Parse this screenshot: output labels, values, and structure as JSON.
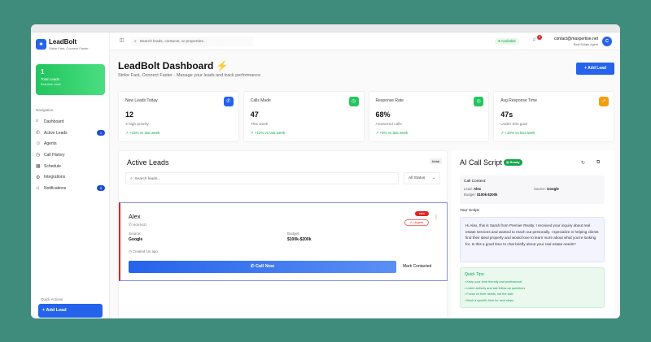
{
  "app": {
    "name": "LeadBolt",
    "tagline": "Strike Fast, Connect Faster"
  },
  "sidebar": {
    "total": {
      "value": "1",
      "label": "Total Leads",
      "sub": "Real-time count"
    },
    "nav_heading": "Navigation",
    "items": [
      {
        "label": "Dashboard",
        "icon": "⌕"
      },
      {
        "label": "Active Leads",
        "icon": "✆",
        "badge": "1"
      },
      {
        "label": "Agents",
        "icon": "☺"
      },
      {
        "label": "Call History",
        "icon": "◷"
      },
      {
        "label": "Schedule",
        "icon": "▦"
      },
      {
        "label": "Integrations",
        "icon": "⚙"
      },
      {
        "label": "Notifications",
        "icon": "♫",
        "badge": "5"
      }
    ],
    "quick_actions": "Quick Actions",
    "add_lead": "+ Add Lead"
  },
  "topbar": {
    "search_placeholder": "Search leads, contacts, or properties...",
    "status": "● Available",
    "notif_count": "2",
    "email": "contact@maxpertise.net",
    "role": "Real Estate Agent",
    "avatar": "C"
  },
  "header": {
    "title": "LeadBolt Dashboard ⚡",
    "subtitle": "Strike Fast, Connect Faster - Manage your leads and track performance",
    "add_lead": "+   Add Lead"
  },
  "stats": [
    {
      "title": "New Leads Today",
      "value": "12",
      "desc": "3 high priority",
      "change": "↗ +23% vs last week",
      "color": "#2563eb",
      "icon": "✆"
    },
    {
      "title": "Calls Made",
      "value": "47",
      "desc": "This week",
      "change": "↗ +12% vs last week",
      "color": "#22c55e",
      "icon": "◷"
    },
    {
      "title": "Response Rate",
      "value": "68%",
      "desc": "Answered calls",
      "change": "↗ +8% vs last week",
      "color": "#22c55e",
      "icon": "◎"
    },
    {
      "title": "Avg Response Time",
      "value": "47s",
      "desc": "Under 60s goal",
      "change": "↗ +15% vs last week",
      "color": "#f59e0b",
      "icon": "↗"
    }
  ],
  "leads": {
    "title": "Active Leads",
    "tag": "Hotal",
    "search_placeholder": "Search leads...",
    "status_filter": "All Status",
    "lead": {
      "name": "Alex",
      "phone": "✆ Hormozi",
      "source_label": "Source:",
      "source": "Google",
      "budget_label": "Budget:",
      "budget": "$100k-$200k",
      "created": "◷ Created 1m ago",
      "new_badge": "new",
      "urgent": "⚠ Urgent",
      "call": "✆   Call Now",
      "mark": "Mark Contacted"
    }
  },
  "script": {
    "title": "AI Call Script",
    "ready": "◎ Ready",
    "context_title": "Call Context:",
    "lead_label": "Lead:",
    "lead": "Alex",
    "source_label": "Source:",
    "source": "Google",
    "budget_label": "Budget:",
    "budget": "$100k-$200k",
    "your_script": "Your Script:",
    "text": "Hi Alex, this is Sarah from Premier Realty. I received your inquiry about real estate services and wanted to reach out personally. I specialize in helping clients find their ideal property and would love to learn more about what you're looking for. Is this a good time to chat briefly about your real estate needs?",
    "tips_title": "Quick Tips:",
    "tips": [
      "• Keep your tone friendly and professional",
      "• Listen actively and ask follow-up questions",
      "• Focus on their needs, not the sale",
      "• Book a specific time for next steps"
    ]
  }
}
